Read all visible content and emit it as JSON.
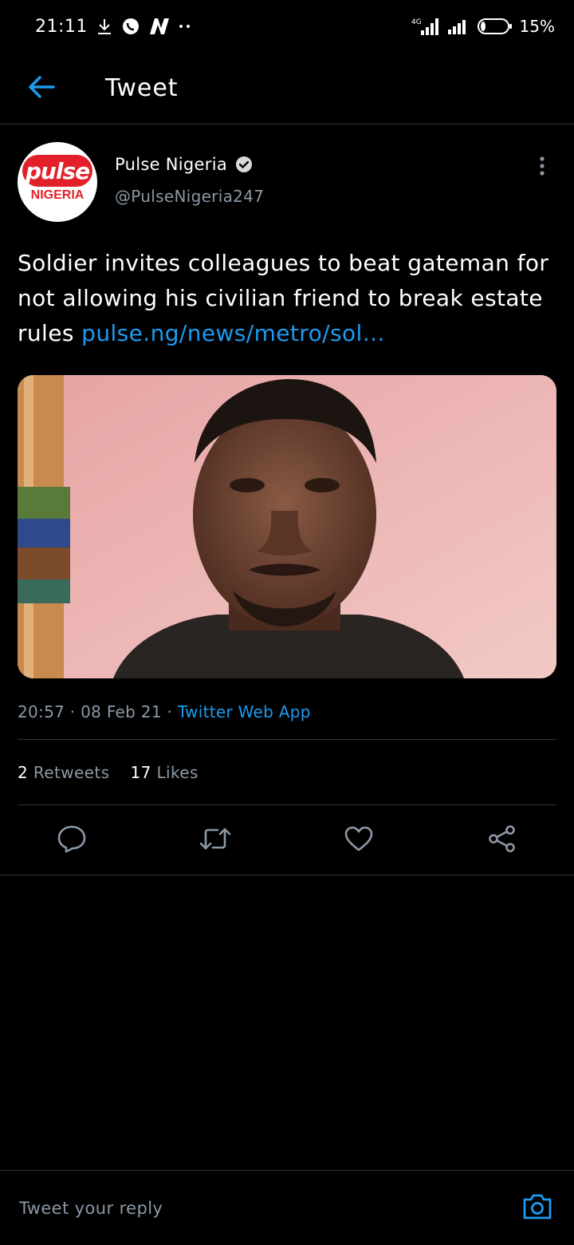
{
  "status_bar": {
    "time": "21:11",
    "network": "4G",
    "battery": "15%",
    "icons": [
      "download-icon",
      "whatsapp-icon",
      "news-app-icon",
      "more-dots-icon",
      "signal-icon",
      "wifi-icon",
      "battery-icon"
    ]
  },
  "header": {
    "title": "Tweet",
    "back_icon": "arrow-left-icon"
  },
  "tweet": {
    "author": {
      "name": "Pulse Nigeria",
      "handle": "@PulseNigeria247",
      "verified": true,
      "avatar_text_top": "pulse",
      "avatar_text_bottom": "NIGERIA"
    },
    "text": "Soldier invites colleagues to beat gateman for not allowing his civilian friend to break estate rules ",
    "link": "pulse.ng/news/metro/sol…",
    "media": {
      "type": "photo",
      "icon": "photo-image"
    },
    "meta": {
      "time": "20:57",
      "date": "08 Feb 21",
      "separator": " · ",
      "source": "Twitter Web App"
    },
    "stats": {
      "retweets_count": "2",
      "retweets_label": "Retweets",
      "likes_count": "17",
      "likes_label": "Likes"
    },
    "actions": [
      "reply-icon",
      "retweet-icon",
      "like-icon",
      "share-icon"
    ]
  },
  "reply_bar": {
    "placeholder": "Tweet your reply",
    "camera_icon": "camera-icon"
  },
  "colors": {
    "background": "#000000",
    "accent": "#1d9bf0",
    "secondary_text": "#8b98a5",
    "divider": "#2f3336",
    "brand_red": "#e3202a"
  }
}
